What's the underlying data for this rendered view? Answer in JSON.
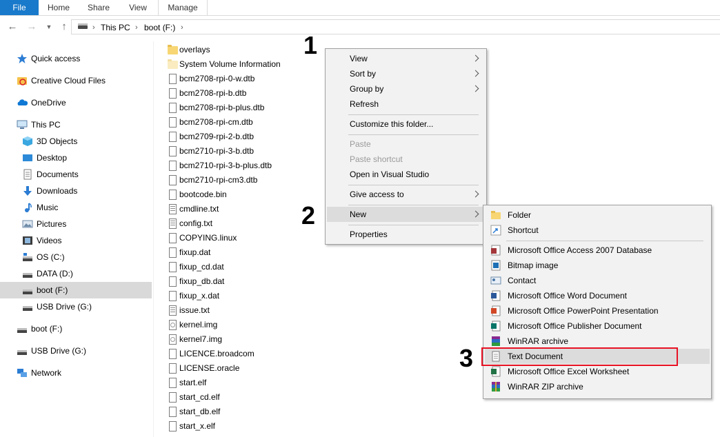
{
  "ribbon": {
    "tabs": [
      "File",
      "Home",
      "Share",
      "View",
      "Manage"
    ]
  },
  "address": {
    "crumbs": [
      "This PC",
      "boot (F:)"
    ]
  },
  "nav_pane": {
    "items": [
      {
        "label": "Quick access",
        "icon": "star-icon"
      },
      {
        "label": "Creative Cloud Files",
        "icon": "creative-cloud-icon"
      },
      {
        "label": "OneDrive",
        "icon": "cloud-icon"
      },
      {
        "label": "This PC",
        "icon": "computer-icon"
      },
      {
        "label": "3D Objects",
        "icon": "cube-icon"
      },
      {
        "label": "Desktop",
        "icon": "desktop-icon"
      },
      {
        "label": "Documents",
        "icon": "documents-icon"
      },
      {
        "label": "Downloads",
        "icon": "download-icon"
      },
      {
        "label": "Music",
        "icon": "music-icon"
      },
      {
        "label": "Pictures",
        "icon": "pictures-icon"
      },
      {
        "label": "Videos",
        "icon": "video-icon"
      },
      {
        "label": "OS (C:)",
        "icon": "drive-icon"
      },
      {
        "label": "DATA (D:)",
        "icon": "drive-icon"
      },
      {
        "label": "boot (F:)",
        "icon": "drive-icon",
        "selected": true
      },
      {
        "label": "USB Drive (G:)",
        "icon": "drive-icon"
      },
      {
        "label": "boot (F:)",
        "icon": "drive-icon"
      },
      {
        "label": "USB Drive (G:)",
        "icon": "drive-icon"
      },
      {
        "label": "Network",
        "icon": "network-icon"
      }
    ]
  },
  "files": [
    {
      "name": "overlays",
      "icon": "folder-icon"
    },
    {
      "name": "System Volume Information",
      "icon": "folder-icon"
    },
    {
      "name": "bcm2708-rpi-0-w.dtb",
      "icon": "file-icon"
    },
    {
      "name": "bcm2708-rpi-b.dtb",
      "icon": "file-icon"
    },
    {
      "name": "bcm2708-rpi-b-plus.dtb",
      "icon": "file-icon"
    },
    {
      "name": "bcm2708-rpi-cm.dtb",
      "icon": "file-icon"
    },
    {
      "name": "bcm2709-rpi-2-b.dtb",
      "icon": "file-icon"
    },
    {
      "name": "bcm2710-rpi-3-b.dtb",
      "icon": "file-icon"
    },
    {
      "name": "bcm2710-rpi-3-b-plus.dtb",
      "icon": "file-icon"
    },
    {
      "name": "bcm2710-rpi-cm3.dtb",
      "icon": "file-icon"
    },
    {
      "name": "bootcode.bin",
      "icon": "file-icon"
    },
    {
      "name": "cmdline.txt",
      "icon": "text-file-icon"
    },
    {
      "name": "config.txt",
      "icon": "text-file-icon"
    },
    {
      "name": "COPYING.linux",
      "icon": "file-icon"
    },
    {
      "name": "fixup.dat",
      "icon": "file-icon"
    },
    {
      "name": "fixup_cd.dat",
      "icon": "file-icon"
    },
    {
      "name": "fixup_db.dat",
      "icon": "file-icon"
    },
    {
      "name": "fixup_x.dat",
      "icon": "file-icon"
    },
    {
      "name": "issue.txt",
      "icon": "text-file-icon"
    },
    {
      "name": "kernel.img",
      "icon": "disc-image-icon"
    },
    {
      "name": "kernel7.img",
      "icon": "disc-image-icon"
    },
    {
      "name": "LICENCE.broadcom",
      "icon": "file-icon"
    },
    {
      "name": "LICENSE.oracle",
      "icon": "file-icon"
    },
    {
      "name": "start.elf",
      "icon": "file-icon"
    },
    {
      "name": "start_cd.elf",
      "icon": "file-icon"
    },
    {
      "name": "start_db.elf",
      "icon": "file-icon"
    },
    {
      "name": "start_x.elf",
      "icon": "file-icon"
    }
  ],
  "steps": [
    "1",
    "2",
    "3"
  ],
  "context_menu": {
    "view": "View",
    "sort_by": "Sort by",
    "group_by": "Group by",
    "refresh": "Refresh",
    "customize": "Customize this folder...",
    "paste": "Paste",
    "paste_shortcut": "Paste shortcut",
    "open_vs": "Open in Visual Studio",
    "give_access": "Give access to",
    "new": "New",
    "properties": "Properties"
  },
  "new_submenu": {
    "items": [
      {
        "label": "Folder",
        "icon": "folder-icon"
      },
      {
        "label": "Shortcut",
        "icon": "shortcut-icon"
      },
      {
        "label": "Microsoft Office Access 2007 Database",
        "icon": "access-icon"
      },
      {
        "label": "Bitmap image",
        "icon": "bitmap-icon"
      },
      {
        "label": "Contact",
        "icon": "contact-icon"
      },
      {
        "label": "Microsoft Office Word Document",
        "icon": "word-icon"
      },
      {
        "label": "Microsoft Office PowerPoint Presentation",
        "icon": "powerpoint-icon"
      },
      {
        "label": "Microsoft Office Publisher Document",
        "icon": "publisher-icon"
      },
      {
        "label": "WinRAR archive",
        "icon": "winrar-icon"
      },
      {
        "label": "Text Document",
        "icon": "text-document-icon",
        "highlighted": true
      },
      {
        "label": "Microsoft Office Excel Worksheet",
        "icon": "excel-icon"
      },
      {
        "label": "WinRAR ZIP archive",
        "icon": "winrar-zip-icon"
      }
    ]
  },
  "colors": {
    "accent": "#1979ca",
    "highlight_box": "#e81123",
    "selection": "#d9d9d9",
    "menu_bg": "#f2f2f2"
  }
}
